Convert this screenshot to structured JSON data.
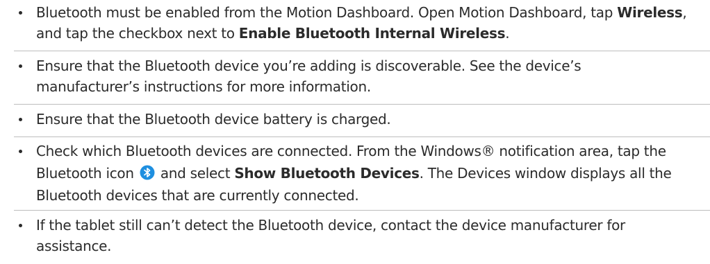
{
  "bullets": [
    {
      "t1": "Bluetooth must be enabled from the Motion Dashboard. Open Motion Dashboard, tap ",
      "b1": "Wireless",
      "t2": ", and tap the checkbox next to ",
      "b2": "Enable Bluetooth Internal Wireless",
      "t3": "."
    },
    {
      "text": "Ensure that the Bluetooth device you’re adding is discoverable. See the device’s manufacturer’s instructions for more information."
    },
    {
      "text": "Ensure that the Bluetooth device battery is charged."
    },
    {
      "t1": "Check which Bluetooth devices are connected. From the Windows® notification area, tap the Bluetooth icon",
      "icon": "bluetooth-icon",
      "t2": "and select ",
      "b1": "Show Bluetooth Devices",
      "t3": ". The Devices window displays all the Bluetooth devices that are currently connected."
    },
    {
      "text": "If the tablet still can’t detect the Bluetooth device, contact the device manufacturer for assistance."
    }
  ],
  "colors": {
    "text": "#2b2b2b",
    "divider": "#bdbdbd",
    "bluetooth": "#1e8fe0"
  }
}
